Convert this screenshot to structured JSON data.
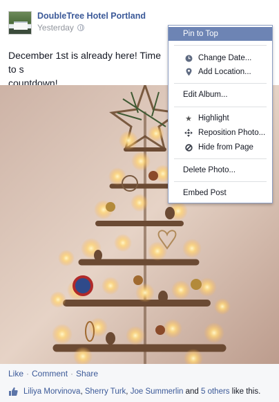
{
  "post": {
    "page_name": "DoubleTree Hotel Portland",
    "timestamp": "Yesterday",
    "privacy_icon": "globe-icon",
    "text_line1": "December 1st is already here! Time to s",
    "text_line2": "countdown!"
  },
  "actions": {
    "like": "Like",
    "comment": "Comment",
    "share": "Share",
    "separator": "·"
  },
  "likes": {
    "icon": "thumbs-up-icon",
    "name1": "Liliya Morvinova",
    "name2": "Sherry Turk",
    "name3": "Joe Summerlin",
    "comma": ",",
    "and": "and",
    "others": "5 others",
    "suffix": "like this."
  },
  "menu": {
    "pin_to_top": "Pin to Top",
    "change_date": "Change Date...",
    "add_location": "Add Location...",
    "edit_album": "Edit Album...",
    "highlight": "Highlight",
    "reposition_photo": "Reposition Photo...",
    "hide_from_page": "Hide from Page",
    "delete_photo": "Delete Photo...",
    "embed_post": "Embed Post"
  },
  "colors": {
    "link": "#3b5998",
    "menu_highlight": "#6d84b4",
    "meta_gray": "#90949c"
  }
}
